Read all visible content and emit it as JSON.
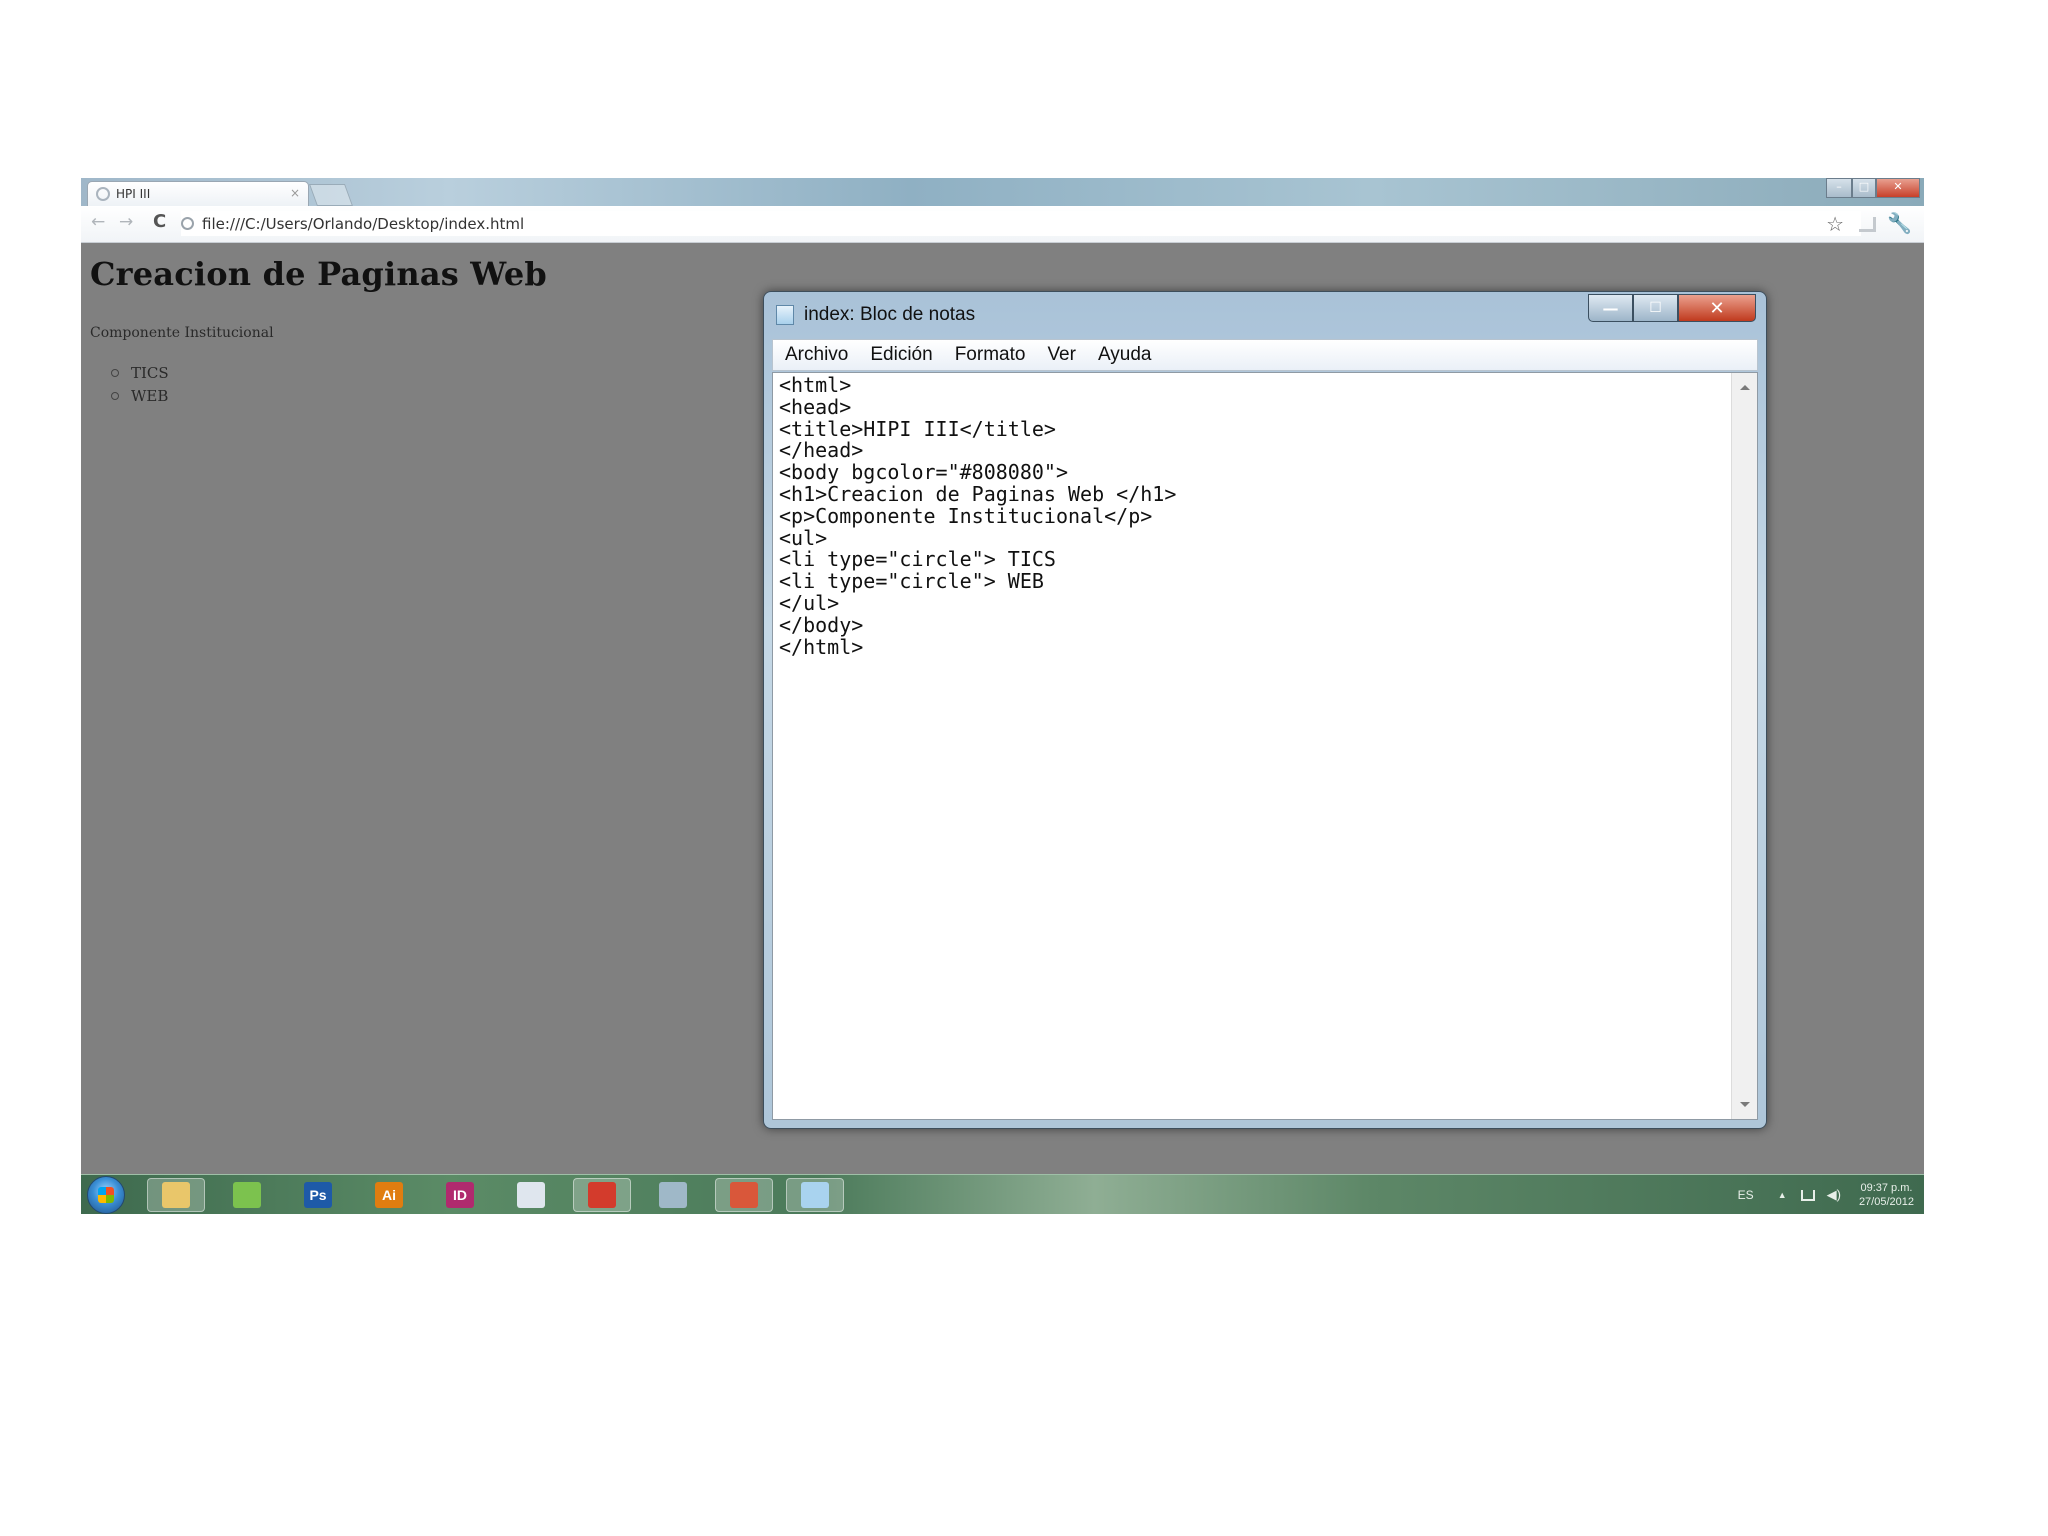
{
  "browser": {
    "tab_title": "HPI III",
    "tab_close": "×",
    "url": "file:///C:/Users/Orlando/Desktop/index.html",
    "icons": [
      "back-arrow-icon",
      "forward-arrow-icon",
      "reload-icon",
      "page-icon",
      "star-icon",
      "wrench-icon"
    ]
  },
  "page": {
    "heading": "Creacion de Paginas Web",
    "paragraph": "Componente Institucional",
    "list_items": [
      "TICS",
      "WEB"
    ]
  },
  "notepad": {
    "title": "index: Bloc de notas",
    "menu": [
      "Archivo",
      "Edición",
      "Formato",
      "Ver",
      "Ayuda"
    ],
    "content": "<html>\n<head>\n<title>HIPI III</title>\n</head>\n<body bgcolor=\"#808080\">\n<h1>Creacion de Paginas Web </h1>\n<p>Componente Institucional</p>\n<ul>\n<li type=\"circle\"> TICS\n<li type=\"circle\"> WEB\n</ul>\n</body>\n</html>"
  },
  "taskbar": {
    "apps": [
      {
        "name": "explorer-icon",
        "label": "",
        "color": "#e9c66a"
      },
      {
        "name": "app-green-icon",
        "label": "",
        "color": "#7cc24e"
      },
      {
        "name": "photoshop-icon",
        "label": "Ps",
        "color": "#1e5aa8"
      },
      {
        "name": "illustrator-icon",
        "label": "Ai",
        "color": "#e07d10"
      },
      {
        "name": "indesign-icon",
        "label": "ID",
        "color": "#b02a6e"
      },
      {
        "name": "phone-icon",
        "label": "",
        "color": "#dfe6ee"
      },
      {
        "name": "chrome-icon",
        "label": "",
        "color": "#d33b2c"
      },
      {
        "name": "network-app-icon",
        "label": "",
        "color": "#9fb8c8"
      },
      {
        "name": "office-icon",
        "label": "",
        "color": "#d9573a"
      },
      {
        "name": "notepad-icon",
        "label": "",
        "color": "#a9d3ef"
      }
    ],
    "tray": {
      "lang": "ES",
      "time": "09:37 p.m.",
      "date": "27/05/2012"
    }
  }
}
